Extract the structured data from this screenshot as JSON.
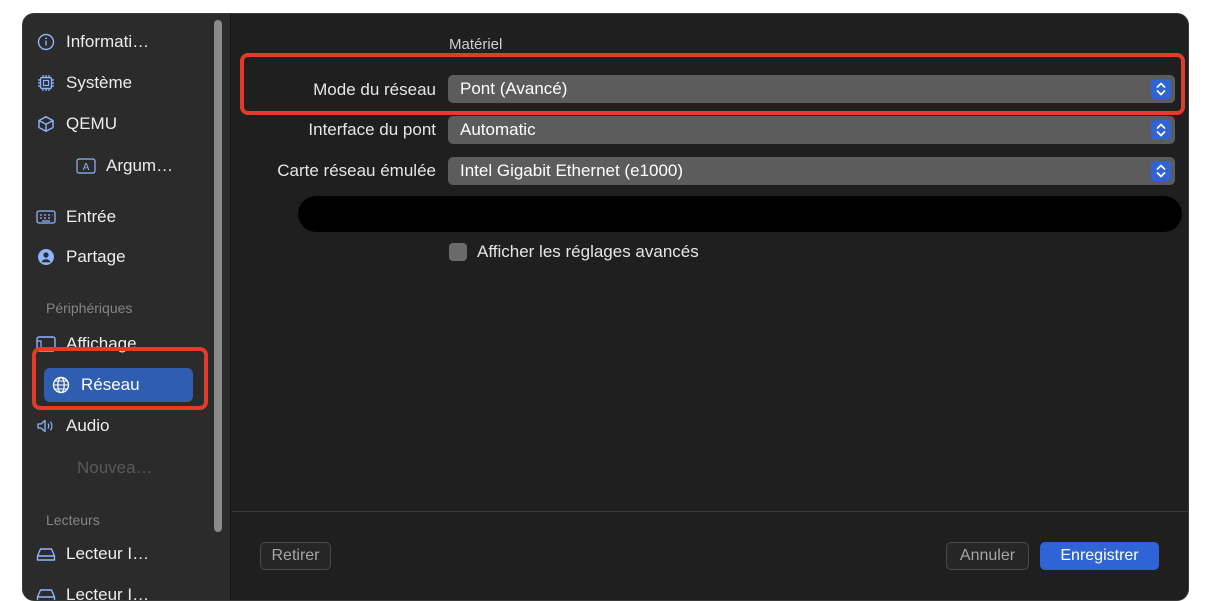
{
  "sidebar": {
    "items": [
      {
        "label": "Informati…",
        "icon": "info-icon"
      },
      {
        "label": "Système",
        "icon": "chip-icon"
      },
      {
        "label": "QEMU",
        "icon": "cube-icon"
      },
      {
        "label": "Argum…",
        "icon": "argument-icon"
      },
      {
        "label": "Entrée",
        "icon": "keyboard-icon"
      },
      {
        "label": "Partage",
        "icon": "person-circle-icon"
      }
    ],
    "section_peripherals": "Périphériques",
    "peripherals": [
      {
        "label": "Affichage",
        "icon": "display-icon"
      },
      {
        "label": "Réseau",
        "icon": "globe-icon"
      },
      {
        "label": "Audio",
        "icon": "speaker-icon"
      },
      {
        "label": "Nouvea…"
      }
    ],
    "section_drives": "Lecteurs",
    "drives": [
      {
        "label": "Lecteur I…",
        "icon": "drive-icon"
      },
      {
        "label": "Lecteur I…",
        "icon": "drive-icon"
      }
    ]
  },
  "main": {
    "section_title": "Matériel",
    "rows": [
      {
        "label": "Mode du réseau",
        "value": "Pont (Avancé)"
      },
      {
        "label": "Interface du pont",
        "value": "Automatic"
      },
      {
        "label": "Carte réseau émulée",
        "value": "Intel Gigabit Ethernet (e1000)"
      }
    ],
    "advanced_checkbox": {
      "label": "Afficher les réglages avancés",
      "checked": false
    }
  },
  "footer": {
    "remove": "Retirer",
    "cancel": "Annuler",
    "save": "Enregistrer"
  },
  "colors": {
    "accent": "#2f64d6",
    "selection": "#2f5eb1",
    "annotation": "#e23b2a"
  }
}
